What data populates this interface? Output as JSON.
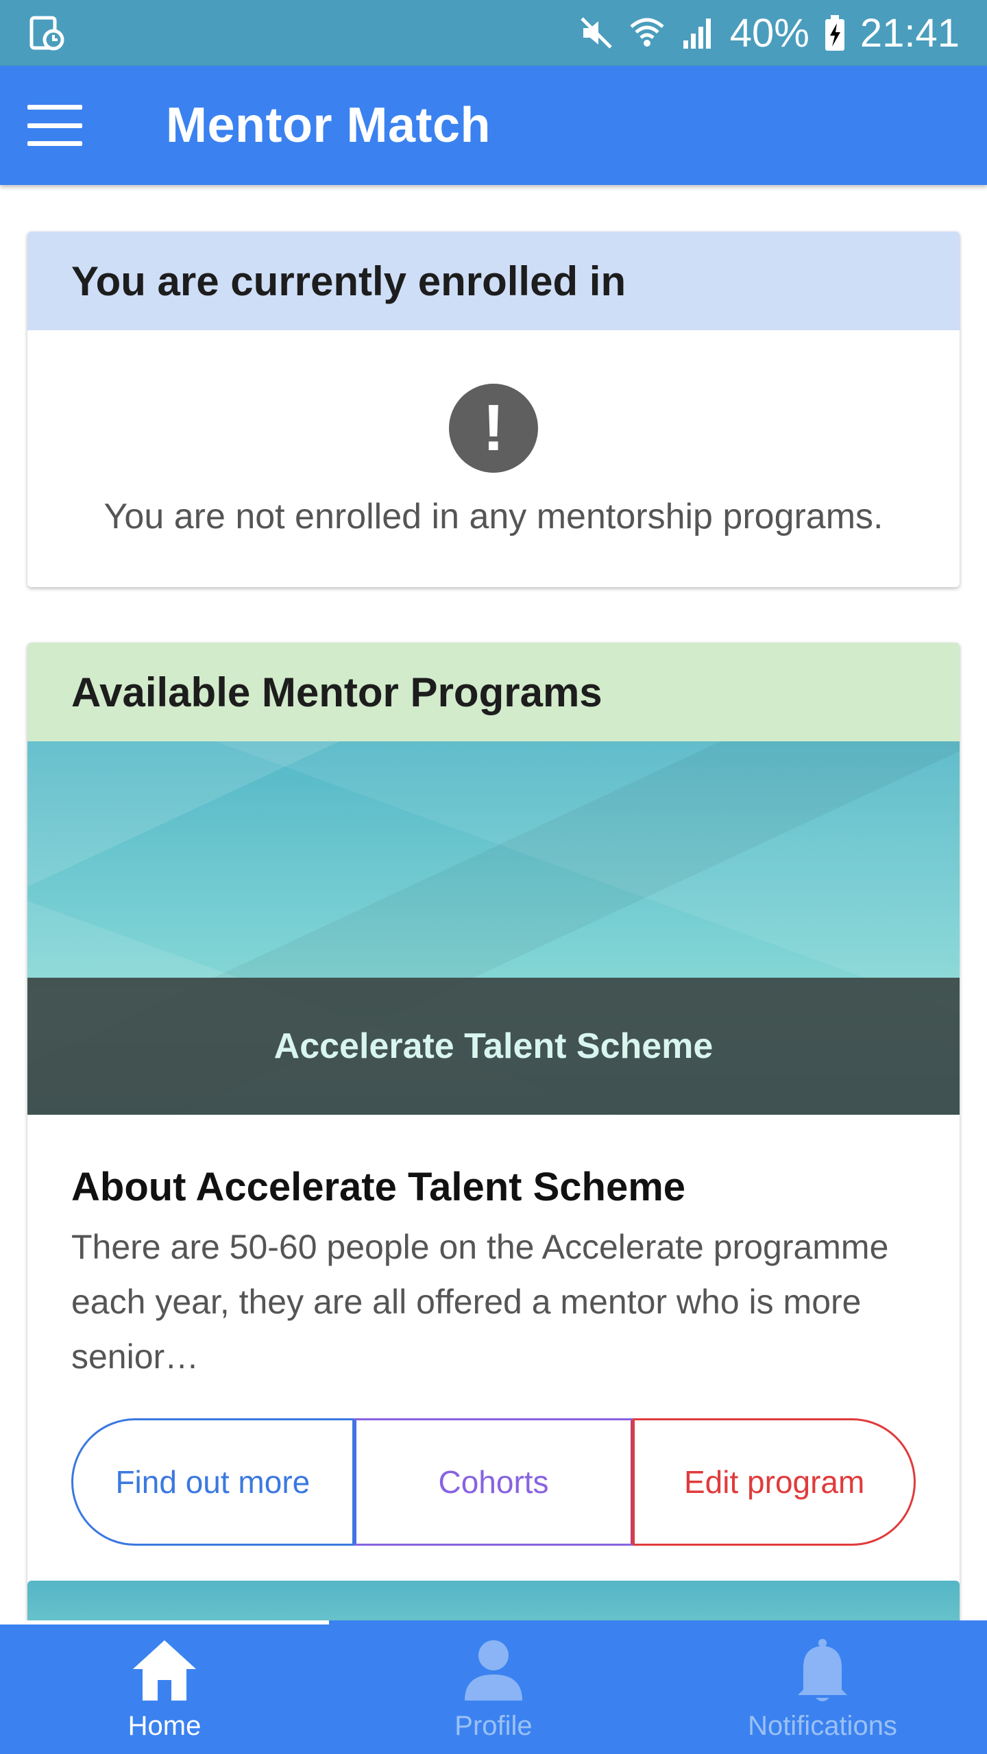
{
  "status_bar": {
    "battery": "40%",
    "time": "21:41"
  },
  "app_bar": {
    "title": "Mentor Match"
  },
  "enrolled_card": {
    "title": "You are currently enrolled in",
    "empty_icon_glyph": "!",
    "empty_message": "You are not enrolled in any mentorship programs."
  },
  "programs_card": {
    "title": "Available Mentor Programs",
    "program": {
      "banner_caption": "Accelerate Talent Scheme",
      "about_title": "About Accelerate Talent Scheme",
      "about_text": "There are 50-60 people on the Accelerate programme each year, they are all offered a mentor who is more senior…",
      "buttons": {
        "find_out_more": "Find out more",
        "cohorts": "Cohorts",
        "edit_program": "Edit program"
      }
    }
  },
  "bottom_nav": {
    "items": [
      {
        "label": "Home",
        "icon": "home-icon",
        "active": true
      },
      {
        "label": "Profile",
        "icon": "person-icon",
        "active": false
      },
      {
        "label": "Notifications",
        "icon": "bell-icon",
        "active": false
      }
    ]
  },
  "colors": {
    "status_bar": "#4a9dbd",
    "primary": "#3b82f0",
    "enrolled_header": "#cfdef7",
    "programs_header": "#d2ebcb",
    "button_blue": "#3b78e0",
    "button_purple": "#8763e0",
    "button_red": "#e03b3b"
  }
}
